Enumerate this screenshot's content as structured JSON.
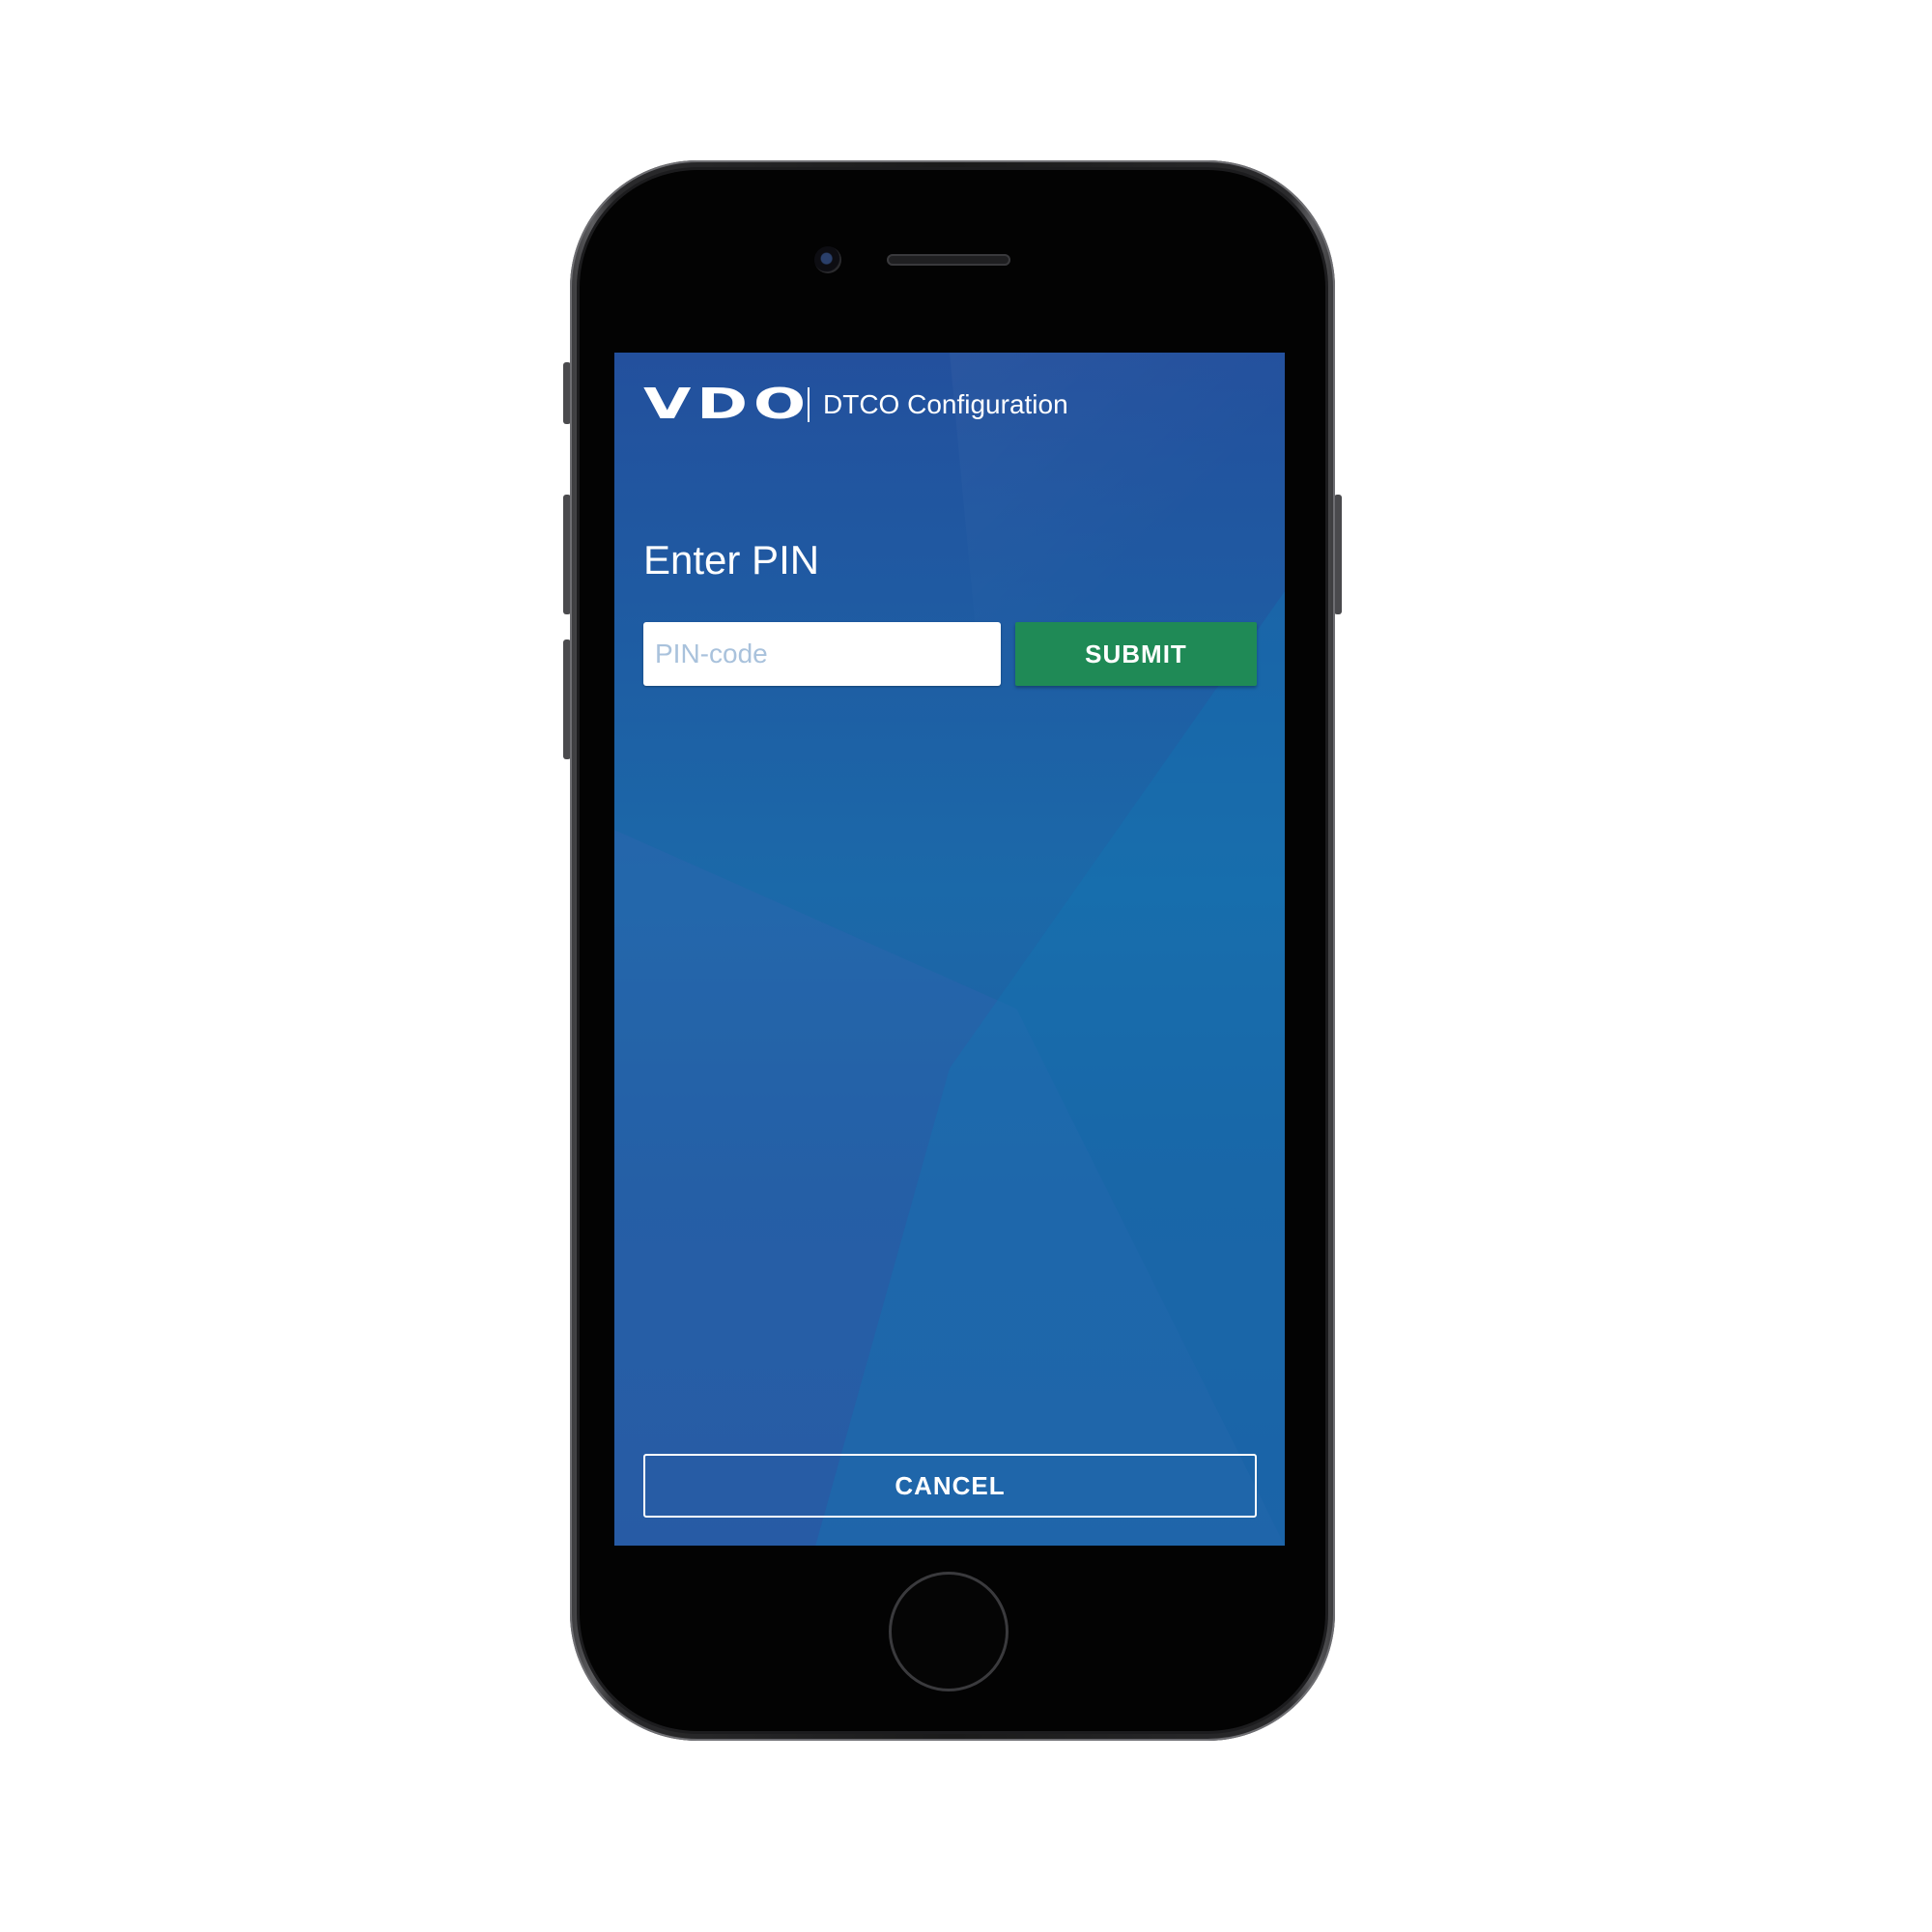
{
  "header": {
    "logo_text": "VDO",
    "app_title": "DTCO Configuration"
  },
  "page": {
    "title": "Enter PIN"
  },
  "pin_field": {
    "value": "",
    "placeholder": "PIN-code"
  },
  "buttons": {
    "submit_label": "SUBMIT",
    "cancel_label": "CANCEL"
  },
  "colors": {
    "screen_background": "#1f5aa2",
    "submit_button": "#1f8a56",
    "text": "#ffffff",
    "placeholder": "#a9c2dc"
  },
  "icons": [
    "camera-icon",
    "speaker-grille",
    "home-button"
  ]
}
